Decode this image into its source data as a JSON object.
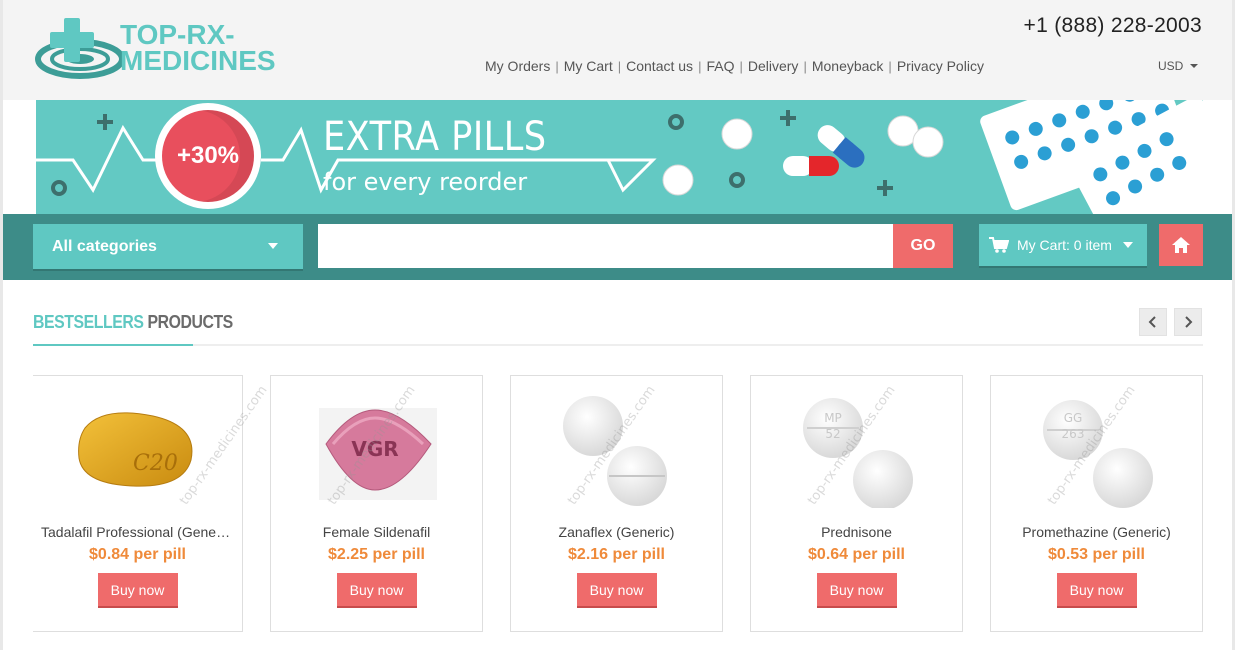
{
  "header": {
    "logo_line1": "TOP-RX-",
    "logo_line2": "MEDICINES",
    "phone": "+1 (888) 228-2003",
    "nav": [
      "My Orders",
      "My Cart",
      "Contact us",
      "FAQ",
      "Delivery",
      "Moneyback",
      "Privacy Policy"
    ],
    "currency": "USD"
  },
  "banner": {
    "badge": "+30%",
    "title": "EXTRA PILLS",
    "subtitle": "for every reorder"
  },
  "toolbar": {
    "category_label": "All categories",
    "search_value": "",
    "search_placeholder": "",
    "go_label": "GO",
    "cart_label": "My Cart: 0 item"
  },
  "section": {
    "title_highlight": "BESTSELLERS",
    "title_rest": "PRODUCTS",
    "prev_icon": "chevron-left-icon",
    "next_icon": "chevron-right-icon"
  },
  "products": [
    {
      "name": "Tadalafil Professional (Generic)",
      "price": "$0.84 per pill",
      "buy": "Buy now",
      "pill_mark": "C20",
      "watermark": "top-rx-medicines.com"
    },
    {
      "name": "Female Sildenafil",
      "price": "$2.25 per pill",
      "buy": "Buy now",
      "pill_mark": "VGR",
      "watermark": "top-rx-medicines.com"
    },
    {
      "name": "Zanaflex (Generic)",
      "price": "$2.16 per pill",
      "buy": "Buy now",
      "pill_mark": "",
      "watermark": "top-rx-medicines.com"
    },
    {
      "name": "Prednisone",
      "price": "$0.64 per pill",
      "buy": "Buy now",
      "pill_mark": "MP 52",
      "watermark": "top-rx-medicines.com"
    },
    {
      "name": "Promethazine (Generic)",
      "price": "$0.53 per pill",
      "buy": "Buy now",
      "pill_mark": "GG 263",
      "watermark": "top-rx-medicines.com"
    }
  ],
  "colors": {
    "brand_teal": "#5fc8c2",
    "dark_teal": "#3d8c88",
    "accent_red": "#ef6b6b",
    "price_orange": "#ef8a3a"
  }
}
